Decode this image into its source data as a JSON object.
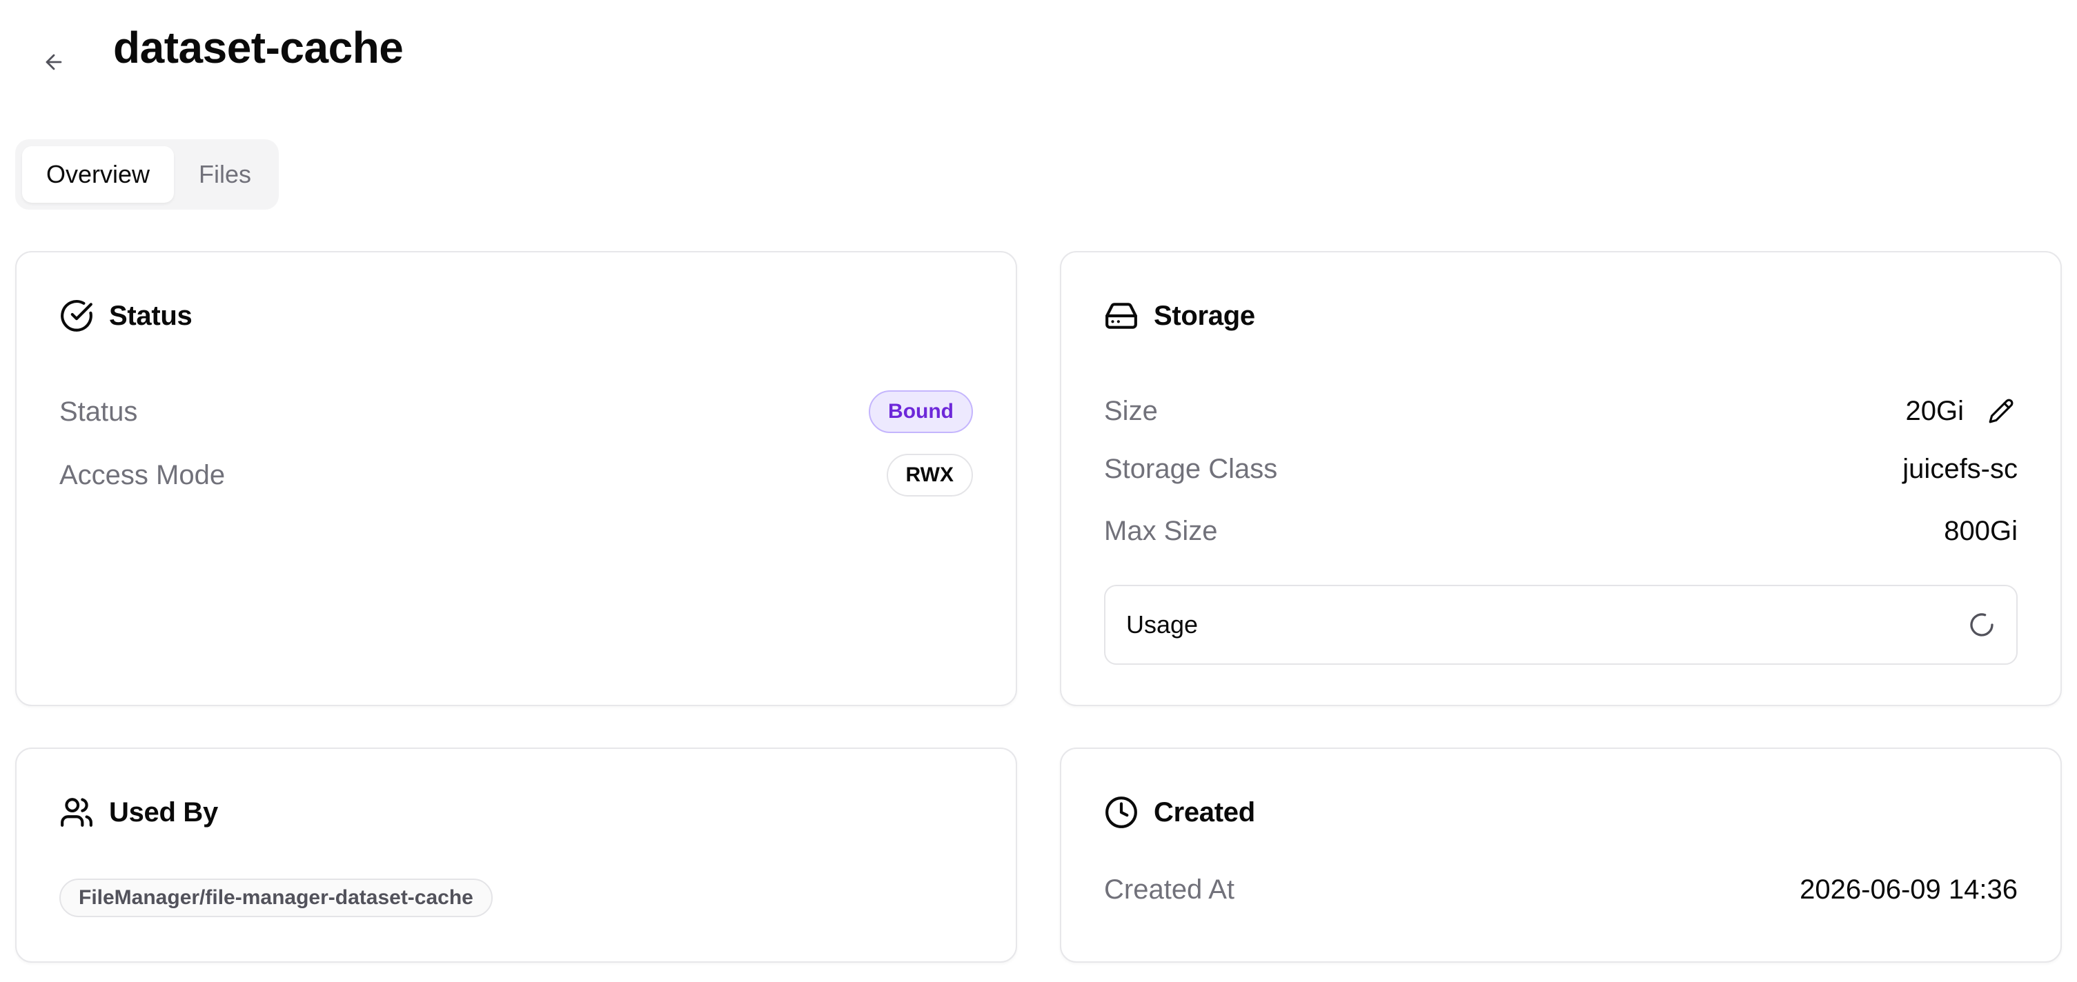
{
  "header": {
    "title": "dataset-cache",
    "back_icon": "arrow-left-icon"
  },
  "tabs": [
    {
      "label": "Overview",
      "active": true
    },
    {
      "label": "Files",
      "active": false
    }
  ],
  "status_card": {
    "title": "Status",
    "icon": "circle-check-icon",
    "rows": [
      {
        "label": "Status",
        "value": "Bound"
      },
      {
        "label": "Access Mode",
        "value": "RWX"
      }
    ]
  },
  "storage_card": {
    "title": "Storage",
    "icon": "hard-drive-icon",
    "size": {
      "label": "Size",
      "value": "20Gi"
    },
    "storage_class": {
      "label": "Storage Class",
      "value": "juicefs-sc"
    },
    "max_size": {
      "label": "Max Size",
      "value": "800Gi"
    },
    "usage": {
      "label": "Usage",
      "state": "loading"
    }
  },
  "used_by_card": {
    "title": "Used By",
    "icon": "users-icon",
    "items": [
      "FileManager/file-manager-dataset-cache"
    ]
  },
  "created_card": {
    "title": "Created",
    "icon": "clock-icon",
    "created_at": {
      "label": "Created At",
      "value": "2026-06-09 14:36"
    }
  },
  "colors": {
    "bound_badge_bg": "#ede9fe",
    "bound_badge_text": "#6d28d9",
    "muted_text": "#71717a",
    "border": "#e7e7ea"
  }
}
